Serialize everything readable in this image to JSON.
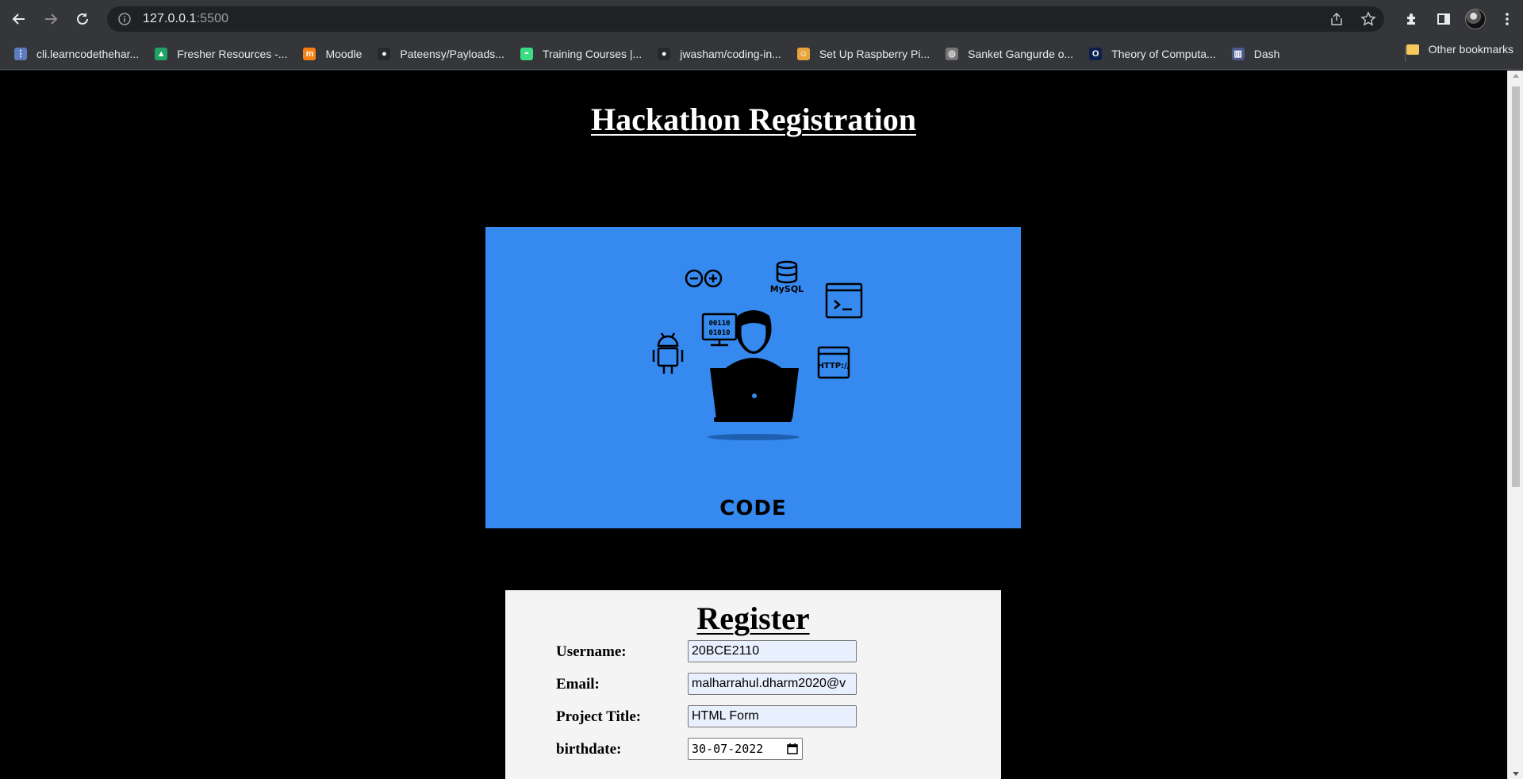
{
  "browser": {
    "url_host": "127.0.0.1",
    "url_port": ":5500",
    "bookmarks": [
      {
        "label": "cli.learncodethehar...",
        "color": "#5c7cbf",
        "glyph": "⋮"
      },
      {
        "label": "Fresher Resources -...",
        "color": "#1fa463",
        "glyph": "▲"
      },
      {
        "label": "Moodle",
        "color": "#f98012",
        "glyph": "m"
      },
      {
        "label": "Pateensy/Payloads...",
        "color": "#24292e",
        "glyph": "●"
      },
      {
        "label": "Training Courses |...",
        "color": "#3ddc84",
        "glyph": "◓"
      },
      {
        "label": "jwasham/coding-in...",
        "color": "#24292e",
        "glyph": "●"
      },
      {
        "label": "Set Up Raspberry Pi...",
        "color": "#e8a33d",
        "glyph": "☺"
      },
      {
        "label": "Sanket Gangurde o...",
        "color": "#777777",
        "glyph": "◎"
      },
      {
        "label": "Theory of Computa...",
        "color": "#0b1f4d",
        "glyph": "O"
      },
      {
        "label": "Dash",
        "color": "#4a5a8a",
        "glyph": "▥"
      }
    ],
    "more_label": "»",
    "other_bookmarks": "Other bookmarks"
  },
  "page": {
    "title": "Hackathon Registration",
    "hero_caption": "CODE",
    "hero_db_label": "MySQL",
    "hero_http_label": "HTTP://",
    "hero_binary_1": "00110",
    "hero_binary_2": "01010",
    "form": {
      "title": "Register",
      "fields": [
        {
          "label": "Username:",
          "value": "20BCE2110"
        },
        {
          "label": "Email:",
          "value": "malharrahul.dharm2020@v"
        },
        {
          "label": "Project Title:",
          "value": "HTML Form"
        },
        {
          "label": "birthdate:",
          "value": "30-07-2022"
        }
      ]
    }
  }
}
